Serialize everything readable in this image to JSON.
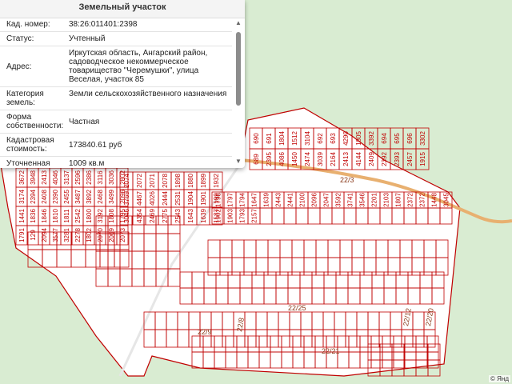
{
  "panel": {
    "title": "Земельный участок",
    "rows": [
      {
        "label": "Кад. номер:",
        "value": "38:26:011401:2398"
      },
      {
        "label": "Статус:",
        "value": "Учтенный"
      },
      {
        "label": "Адрес:",
        "value": "Иркутская область, Ангарский район, садоводческое некоммерческое товарищество \"Черемушки\", улица Веселая, участок 85"
      },
      {
        "label": "Категория земель:",
        "value": "Земли сельскохозяйственного назначения"
      },
      {
        "label": "Форма собственности:",
        "value": "Частная"
      },
      {
        "label": "Кадастровая стоимость:",
        "value": "173840.61 руб"
      },
      {
        "label": "Уточненная площадь:",
        "value": "1009 кв.м"
      }
    ]
  },
  "colors": {
    "boundary": "#c00000",
    "forest": "#d9ecd2",
    "field": "#ffffff",
    "road": "#e8b070"
  },
  "map": {
    "copyright": "© Янд",
    "streets": [
      "22/3",
      "22/25",
      "22/9",
      "22/21",
      "22/12",
      "22/20",
      "22/8"
    ],
    "plots": [
      "690",
      "691",
      "1804",
      "1512",
      "3104",
      "692",
      "693",
      "4290",
      "1805",
      "3392",
      "694",
      "695",
      "696",
      "3302",
      "689",
      "2395",
      "4086",
      "1450",
      "2474",
      "3039",
      "2164",
      "2413",
      "4144",
      "2409",
      "2392",
      "2393",
      "2457",
      "1915",
      "3672",
      "3948",
      "2413",
      "4046",
      "3137",
      "2596",
      "2386",
      "3116",
      "3036",
      "2802",
      "3174",
      "2394",
      "2408",
      "2390",
      "2455",
      "3487",
      "3892",
      "2468",
      "3499",
      "2096",
      "1441",
      "1836",
      "1846",
      "1810",
      "1811",
      "2542",
      "1800",
      "3192",
      "1808",
      "1795",
      "1791",
      "129",
      "2094",
      "3577",
      "3281",
      "2278",
      "1802",
      "2070",
      "2069",
      "2073",
      "2074",
      "2072",
      "2071",
      "2078",
      "1898",
      "1880",
      "1899",
      "1932",
      "3769",
      "4467",
      "4026",
      "2444",
      "2531",
      "1904",
      "1901",
      "199",
      "3046",
      "4354",
      "2469",
      "2775",
      "2543",
      "1643",
      "1639",
      "1587",
      "1798",
      "1797",
      "1794",
      "1647",
      "1639",
      "2443",
      "2441",
      "2100",
      "2096",
      "2047",
      "3592",
      "3741",
      "3546",
      "2201",
      "2103",
      "1807",
      "2372",
      "2372",
      "1448",
      "3045",
      "1902",
      "1903",
      "1793",
      "2157"
    ]
  }
}
